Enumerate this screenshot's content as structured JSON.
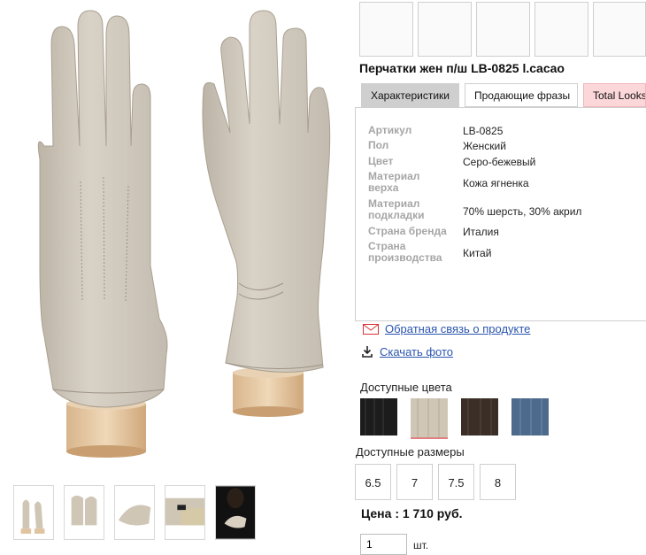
{
  "product": {
    "title": "Перчатки жен п/ш LB-0825 l.cacao"
  },
  "tabs": [
    {
      "label": "Характеристики",
      "active": true
    },
    {
      "label": "Продающие фразы",
      "active": false
    },
    {
      "label": "Total Looks",
      "active": false
    }
  ],
  "specs": [
    {
      "label": "Артикул",
      "value": "LB-0825"
    },
    {
      "label": "Пол",
      "value": "Женский"
    },
    {
      "label": "Цвет",
      "value": "Серо-бежевый"
    },
    {
      "label": "Материал верха",
      "value": "Кожа ягненка"
    },
    {
      "label": "Материал подкладки",
      "value": "70% шерсть, 30% акрил"
    },
    {
      "label": "Страна бренда",
      "value": "Италия"
    },
    {
      "label": "Страна производства",
      "value": "Китай"
    }
  ],
  "links": {
    "feedback": "Обратная связь о продукте",
    "download": "Скачать фото"
  },
  "colors": {
    "label": "Доступные цвета",
    "swatches": [
      {
        "name": "black",
        "hex": "#1c1c1c"
      },
      {
        "name": "beige",
        "hex": "#cfc6b6",
        "selected": true
      },
      {
        "name": "brown",
        "hex": "#3a2e27"
      },
      {
        "name": "blue",
        "hex": "#4d6a8c"
      }
    ],
    "accent_underline": "#e08080"
  },
  "sizes": {
    "label": "Доступные размеры",
    "options": [
      "6.5",
      "7",
      "7.5",
      "8"
    ]
  },
  "price": {
    "text": "Цена : 1 710 руб."
  },
  "quantity": {
    "value": "1",
    "unit": "шт."
  },
  "icons": {
    "feedback": "envelope-icon",
    "download": "download-icon"
  }
}
